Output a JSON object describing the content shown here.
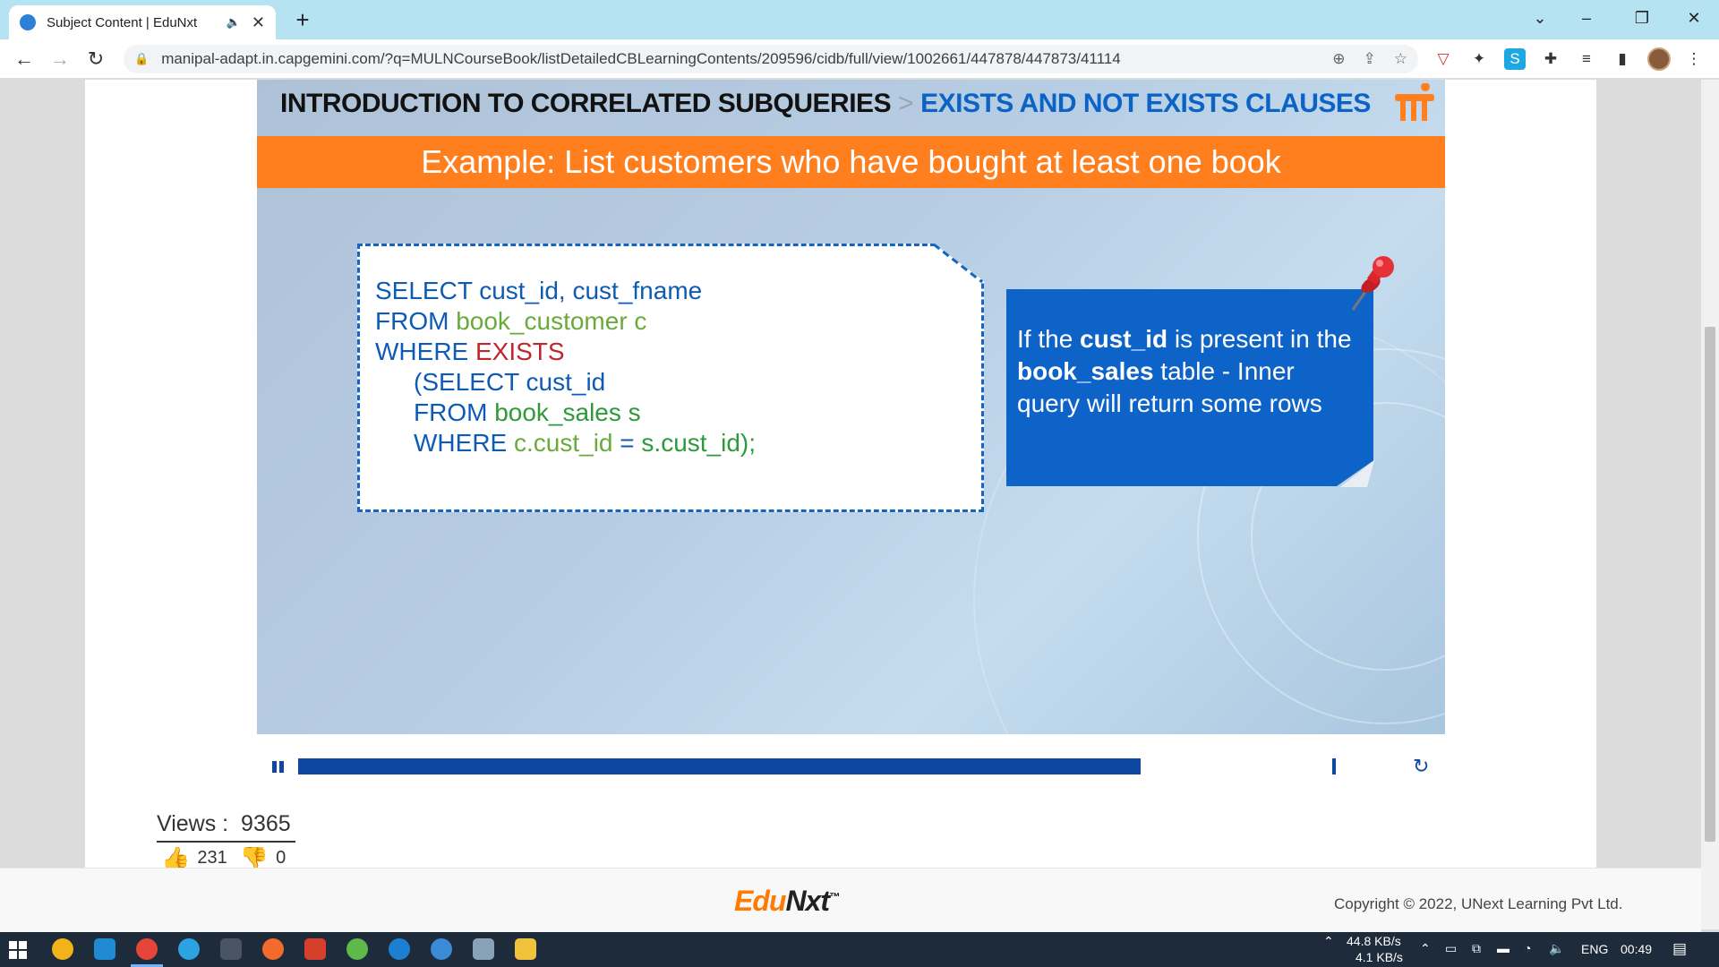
{
  "browser": {
    "tab_title": "Subject Content | EduNxt",
    "tab_audio": "🔈",
    "tab_close": "✕",
    "new_tab": "+",
    "url": "manipal-adapt.in.capgemini.com/?q=MULNCourseBook/listDetailedCBLearningContents/209596/cidb/full/view/1002661/447878/447873/41114"
  },
  "slide": {
    "breadcrumb_main": "INTRODUCTION TO CORRELATED SUBQUERIES",
    "breadcrumb_sep": ">",
    "breadcrumb_sub": "EXISTS AND NOT EXISTS CLAUSES",
    "banner": "Example: List customers who have bought at least one book",
    "code": {
      "l1": "SELECT cust_id, cust_fname",
      "l2_kw": "FROM ",
      "l2_tbl": "book_customer c",
      "l3_kw": "WHERE ",
      "l3_exists": "EXISTS",
      "l4": "(SELECT cust_id",
      "l5_kw": "FROM ",
      "l5_tbl": "book_sales s",
      "l6_kw": "WHERE ",
      "l6_a": "c.cust_id",
      "l6_b": " = ",
      "l6_c": "s.cust_id);"
    },
    "note": {
      "t1": "If the ",
      "b1": "cust_id",
      "t2": " is present in the ",
      "b2": "book_sales",
      "t3": " table  - Inner query will return some rows"
    }
  },
  "player": {
    "progress_fraction": 0.815,
    "replay_icon": "↻"
  },
  "stats": {
    "views_label": "Views :",
    "views_value": "9365",
    "likes": "231",
    "dislikes": "0"
  },
  "footer": {
    "brand_a": "Edu",
    "brand_b": "Nxt",
    "brand_tm": "™",
    "copyright": "Copyright © 2022, UNext Learning Pvt Ltd."
  },
  "taskbar": {
    "net_down": "44.8 KB/s",
    "net_up": "4.1 KB/s",
    "lang": "ENG",
    "time": "00:49"
  },
  "colors": {
    "accent_orange": "#ff7f1f",
    "accent_blue": "#0d63c8",
    "progress_blue": "#0d47a1"
  }
}
